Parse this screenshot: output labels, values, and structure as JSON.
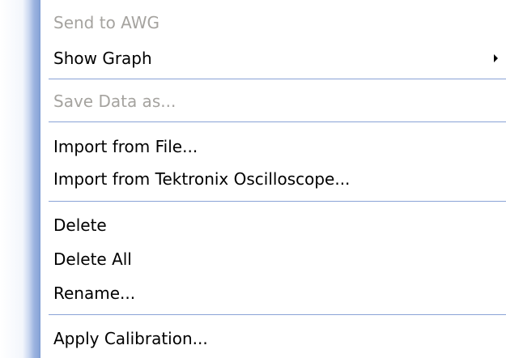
{
  "menu": {
    "items": [
      {
        "label": "Send to AWG",
        "disabled": true
      },
      {
        "label": "Show Graph",
        "has_submenu": true
      },
      {
        "label": "Save Data as...",
        "disabled": true
      },
      {
        "label": "Import from File..."
      },
      {
        "label": "Import from Tektronix Oscilloscope..."
      },
      {
        "label": "Delete"
      },
      {
        "label": "Delete All"
      },
      {
        "label": "Rename..."
      },
      {
        "label": "Apply Calibration..."
      }
    ]
  },
  "colors": {
    "disabled_text": "#a5a39f",
    "separator": "#8aa3d6",
    "gutter_accent": "#7d9bd3"
  }
}
